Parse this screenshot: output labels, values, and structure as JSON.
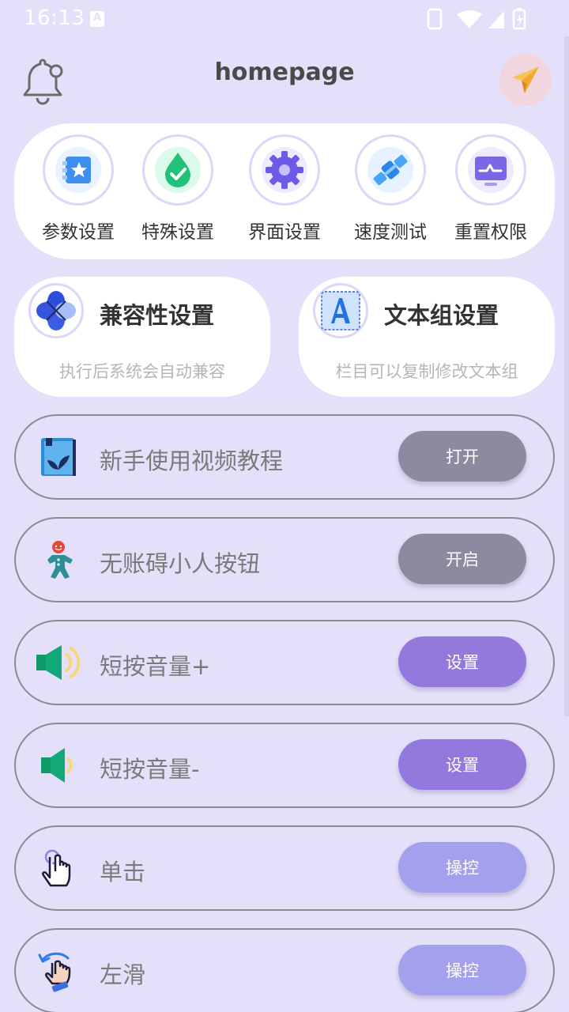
{
  "status_bar": {
    "time": "16:13"
  },
  "header": {
    "title": "homepage"
  },
  "settings": [
    {
      "label": "参数设置",
      "icon": "star-card-icon"
    },
    {
      "label": "特殊设置",
      "icon": "checkmark-drop-icon"
    },
    {
      "label": "界面设置",
      "icon": "gear-icon"
    },
    {
      "label": "速度测试",
      "icon": "satellite-icon"
    },
    {
      "label": "重置权限",
      "icon": "monitor-icon"
    }
  ],
  "cards": [
    {
      "title": "兼容性设置",
      "subtitle": "执行后系统会自动兼容",
      "icon": "petals-icon"
    },
    {
      "title": "文本组设置",
      "subtitle": "栏目可以复制修改文本组",
      "icon": "letter-a-icon"
    }
  ],
  "rows": [
    {
      "label": "新手使用视频教程",
      "button": "打开",
      "icon": "book-icon"
    },
    {
      "label": "无账碍小人按钮",
      "button": "开启",
      "icon": "gingerbread-icon"
    },
    {
      "label": "短按音量+",
      "button": "设置",
      "icon": "volume-up-icon"
    },
    {
      "label": "短按音量-",
      "button": "设置",
      "icon": "volume-down-icon"
    },
    {
      "label": "单击",
      "button": "操控",
      "icon": "tap-hand-icon"
    },
    {
      "label": "左滑",
      "button": "操控",
      "icon": "swipe-hand-icon"
    }
  ],
  "colors": {
    "background": "#e4e0f9",
    "button_gray": "#8d899e",
    "button_purple": "#9378de",
    "button_lavender": "#a3a1ee"
  }
}
